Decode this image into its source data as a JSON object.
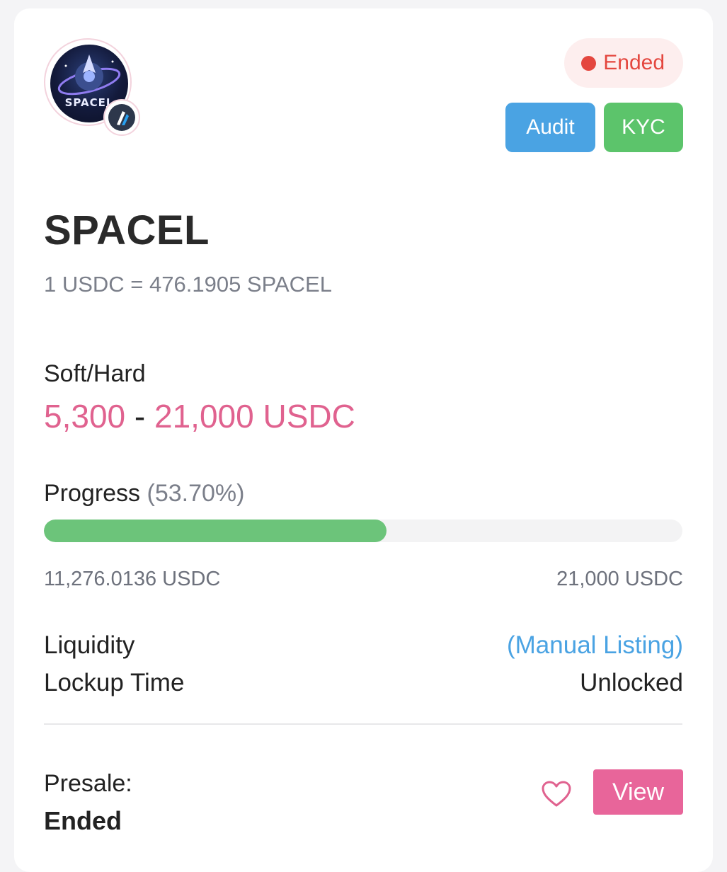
{
  "header": {
    "status": "Ended",
    "tags": {
      "audit": "Audit",
      "kyc": "KYC"
    },
    "logo_icon": "spacel-logo-icon",
    "chain_icon": "arbitrum-icon"
  },
  "token": {
    "name": "SPACEL",
    "rate": "1 USDC = 476.1905 SPACEL"
  },
  "caps": {
    "label": "Soft/Hard",
    "soft": "5,300",
    "separator": "-",
    "hard": "21,000 USDC"
  },
  "progress": {
    "label": "Progress",
    "percent_text": "(53.70%)",
    "percent": 53.7,
    "raised": "11,276.0136 USDC",
    "target": "21,000 USDC"
  },
  "details": {
    "liquidity_label": "Liquidity",
    "liquidity_value": "(Manual Listing)",
    "lockup_label": "Lockup Time",
    "lockup_value": "Unlocked"
  },
  "footer": {
    "presale_label": "Presale:",
    "presale_status": "Ended",
    "view_label": "View"
  },
  "colors": {
    "accent_pink": "#e0628f",
    "progress_green": "#6cc47a",
    "status_red": "#e4473f",
    "audit_blue": "#4aa3e3",
    "kyc_green": "#5cc46b"
  }
}
